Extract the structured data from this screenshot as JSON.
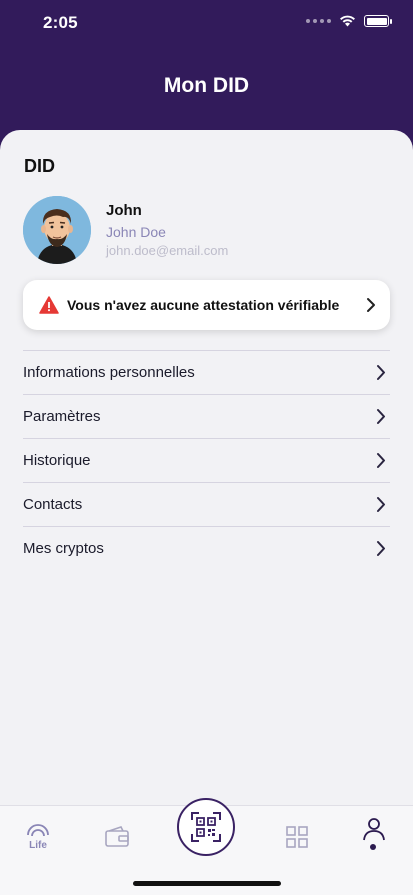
{
  "status_bar": {
    "time": "2:05"
  },
  "header": {
    "title": "Mon DID"
  },
  "section": {
    "title": "DID"
  },
  "profile": {
    "name": "John",
    "full_name": "John Doe",
    "email": "john.doe@email.com"
  },
  "alert": {
    "text": "Vous n'avez aucune attestation vérifiable",
    "icon": "warning-icon",
    "icon_color": "#e53935"
  },
  "menu": {
    "items": [
      {
        "label": "Informations personnelles"
      },
      {
        "label": "Paramètres"
      },
      {
        "label": "Historique"
      },
      {
        "label": "Contacts"
      },
      {
        "label": "Mes cryptos"
      }
    ]
  },
  "tabbar": {
    "tabs": [
      {
        "icon": "life-icon",
        "label": "Life"
      },
      {
        "icon": "wallet-icon"
      },
      {
        "icon": "qr-scan-icon"
      },
      {
        "icon": "apps-grid-icon"
      },
      {
        "icon": "profile-icon",
        "active": true
      }
    ]
  },
  "colors": {
    "header_bg": "#321b5b",
    "content_bg": "#f2f2f5",
    "accent": "#3a2264",
    "muted_text": "#8a86b6"
  }
}
